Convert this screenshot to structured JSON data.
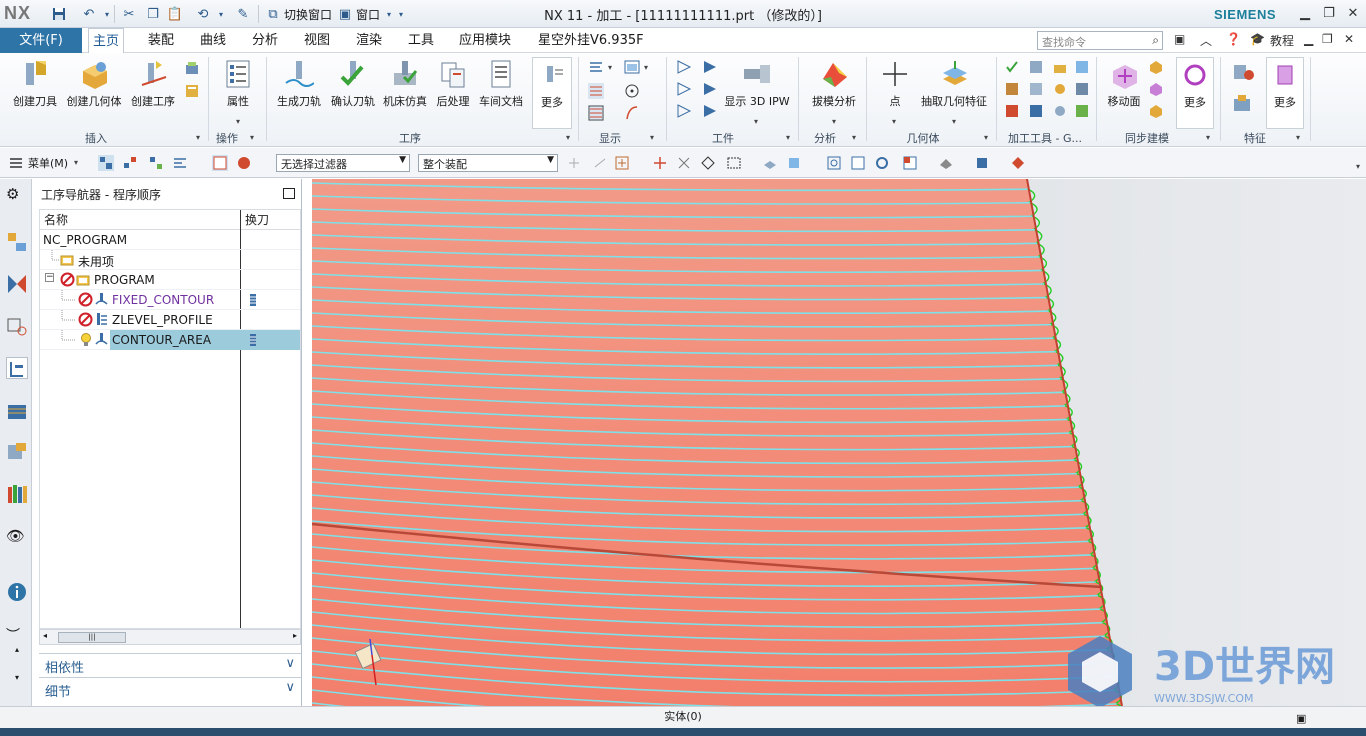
{
  "app": {
    "logo": "NX",
    "title": "NX 11 - 加工 - [11111111111.prt （修改的）]",
    "brand": "SIEMENS",
    "quick_access": {
      "switch_window": "切换窗口",
      "window": "窗口"
    },
    "accent_color": "#2f74a6"
  },
  "menubar": {
    "file_tab": "文件(F)",
    "tabs": [
      "主页",
      "装配",
      "曲线",
      "分析",
      "视图",
      "渲染",
      "工具",
      "应用模块",
      "星空外挂V6.935F"
    ],
    "active_tab": "主页",
    "search_placeholder": "查找命令",
    "tutorial": "教程"
  },
  "ribbon": {
    "groups": {
      "insert": {
        "label": "插入",
        "buttons": [
          "创建刀具",
          "创建几何体",
          "创建工序"
        ]
      },
      "operation": {
        "label": "操作",
        "buttons": [
          "属性"
        ]
      },
      "procedure": {
        "label": "工序",
        "buttons": [
          "生成刀轨",
          "确认刀轨",
          "机床仿真",
          "后处理",
          "车间文档",
          "更多"
        ]
      },
      "display": {
        "label": "显示"
      },
      "workpiece": {
        "label": "工件",
        "buttons": [
          "显示 3D IPW"
        ]
      },
      "analysis": {
        "label": "分析",
        "buttons": [
          "拔模分析"
        ]
      },
      "geometry": {
        "label": "几何体",
        "buttons": [
          "点",
          "抽取几何特征"
        ]
      },
      "mfg_tools": {
        "label": "加工工具 - G..."
      },
      "sync": {
        "label": "同步建模",
        "buttons": [
          "移动面",
          "更多"
        ]
      },
      "feature": {
        "label": "特征",
        "buttons": [
          "更多"
        ]
      }
    }
  },
  "toolbar2": {
    "menu_label": "菜单(M)",
    "filter_value": "无选择过滤器",
    "assembly_scope": "整个装配"
  },
  "navigator": {
    "title": "工序导航器 - 程序顺序",
    "columns": [
      "名称",
      "换刀"
    ],
    "rows": [
      {
        "name": "NC_PROGRAM",
        "level": 0
      },
      {
        "name": "未用项",
        "level": 1
      },
      {
        "name": "PROGRAM",
        "level": 1
      },
      {
        "name": "FIXED_CONTOUR",
        "level": 2
      },
      {
        "name": "ZLEVEL_PROFILE",
        "level": 2
      },
      {
        "name": "CONTOUR_AREA",
        "level": 2
      }
    ],
    "selected_row": "CONTOUR_AREA",
    "accordions": [
      "相依性",
      "细节"
    ]
  },
  "status": {
    "text": "实体(0)"
  },
  "watermark": {
    "text": "3D世界网",
    "url": "WWW.3DSJW.COM"
  }
}
